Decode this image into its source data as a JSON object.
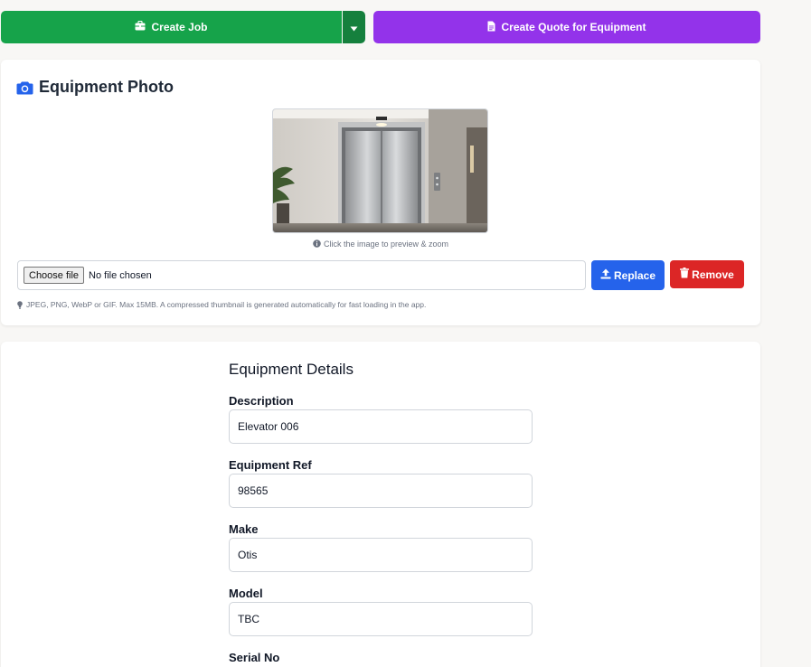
{
  "actions": {
    "create_job_label": "Create Job",
    "create_quote_label": "Create Quote for Equipment"
  },
  "photo": {
    "title": "Equipment Photo",
    "hint": "Click the image to preview & zoom",
    "file_button": "Choose file",
    "file_status": "No file chosen",
    "replace_label": "Replace",
    "remove_label": "Remove",
    "note": "JPEG, PNG, WebP or GIF. Max 15MB. A compressed thumbnail is generated automatically for fast loading in the app."
  },
  "details": {
    "title": "Equipment Details",
    "fields": [
      {
        "label": "Description",
        "value": "Elevator 006"
      },
      {
        "label": "Equipment Ref",
        "value": "98565"
      },
      {
        "label": "Make",
        "value": "Otis"
      },
      {
        "label": "Model",
        "value": "TBC"
      },
      {
        "label": "Serial No",
        "value": ""
      }
    ]
  },
  "colors": {
    "green": "#16a34a",
    "green_dark": "#15803d",
    "purple": "#9333ea",
    "blue": "#2563eb",
    "red": "#dc2626"
  }
}
